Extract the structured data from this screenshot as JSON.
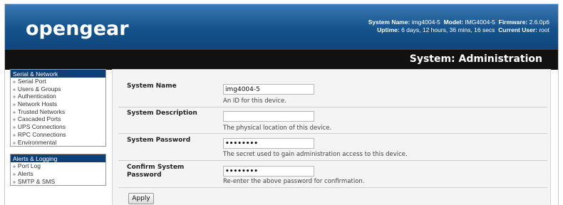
{
  "header": {
    "logo": "opengear",
    "system_name_label": "System Name:",
    "system_name": "img4004-5",
    "model_label": "Model:",
    "model": "IMG4004-5",
    "firmware_label": "Firmware:",
    "firmware": "2.6.0p6",
    "uptime_label": "Uptime:",
    "uptime": "6 days, 12 hours, 36 mins, 16 secs",
    "user_label": "Current User:",
    "user": "root",
    "page_title": "System: Administration"
  },
  "sidebar": {
    "sections": [
      {
        "title": "Serial & Network",
        "items": [
          "Serial Port",
          "Users & Groups",
          "Authentication",
          "Network Hosts",
          "Trusted Networks",
          "Cascaded Ports",
          "UPS Connections",
          "RPC Connections",
          "Environmental"
        ]
      },
      {
        "title": "Alerts & Logging",
        "items": [
          "Port Log",
          "Alerts",
          "SMTP & SMS"
        ]
      }
    ],
    "bullet": "»"
  },
  "form": {
    "system_name": {
      "label": "System Name",
      "value": "img4004-5",
      "help": "An ID for this device."
    },
    "system_description": {
      "label": "System Description",
      "value": "",
      "help": "The physical location of this device."
    },
    "system_password": {
      "label": "System Password",
      "value": "••••••••",
      "help": "The secret used to gain administration access to this device."
    },
    "confirm_password": {
      "label": "Confirm System",
      "label2": "Password",
      "value": "••••••••",
      "help": "Re-enter the above password for confirmation."
    },
    "apply_label": "Apply"
  }
}
